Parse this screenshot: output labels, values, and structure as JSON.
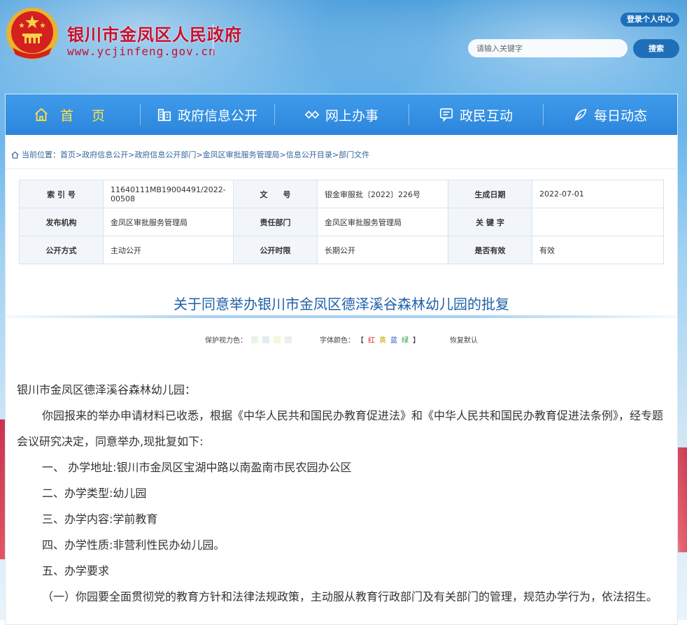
{
  "header": {
    "site_title": "银川市金凤区人民政府",
    "site_url": "www.ycjinfeng.gov.cn",
    "login_label": "登录个人中心",
    "search_placeholder": "请输入关键字",
    "search_button": "搜索"
  },
  "nav": {
    "items": [
      {
        "label": "首 页",
        "icon": "home-icon"
      },
      {
        "label": "政府信息公开",
        "icon": "building-icon"
      },
      {
        "label": "网上办事",
        "icon": "handshake-icon"
      },
      {
        "label": "政民互动",
        "icon": "chat-icon"
      },
      {
        "label": "每日动态",
        "icon": "leaf-icon"
      }
    ]
  },
  "breadcrumb": {
    "prefix": "当前位置：",
    "items": [
      "首页",
      "政府信息公开",
      "政府信息公开部门",
      "金凤区审批服务管理局",
      "信息公开目录",
      "部门文件"
    ],
    "separator": ">"
  },
  "meta": {
    "rows": [
      [
        {
          "k": "索 引 号",
          "v": "11640111MB19004491/2022-00508"
        },
        {
          "k": "文　　号",
          "v": "银金审服批〔2022〕226号"
        },
        {
          "k": "生成日期",
          "v": "2022-07-01"
        }
      ],
      [
        {
          "k": "发布机构",
          "v": "金凤区审批服务管理局"
        },
        {
          "k": "责任部门",
          "v": "金凤区审批服务管理局"
        },
        {
          "k": "关 键 字",
          "v": ""
        }
      ],
      [
        {
          "k": "公开方式",
          "v": "主动公开"
        },
        {
          "k": "公开时限",
          "v": "长期公开"
        },
        {
          "k": "是否有效",
          "v": "有效"
        }
      ]
    ]
  },
  "article": {
    "title": "关于同意举办银川市金凤区德泽溪谷森林幼儿园的批复",
    "tools": {
      "eye_label": "保护视力色：",
      "font_label": "字体颜色：",
      "bracket_open": "【",
      "red": "红",
      "yellow": "黄",
      "blue": "蓝",
      "green": "绿",
      "bracket_close": "】",
      "reset": "恢复默认"
    },
    "paragraphs": [
      "银川市金凤区德泽溪谷森林幼儿园：",
      "你园报来的举办申请材料已收悉，根据《中华人民共和国民办教育促进法》和《中华人民共和国民办教育促进法条例》，经专题会议研究决定，同意举办,现批复如下:",
      "一、 办学地址:银川市金凤区宝湖中路以南盈南市民农园办公区",
      "二、办学类型:幼儿园",
      "三、办学内容:学前教育",
      "四、办学性质:非营利性民办幼儿园。",
      "五、办学要求",
      "（一）你园要全面贯彻党的教育方针和法律法规政策，主动服从教育行政部门及有关部门的管理，规范办学行为，依法招生。"
    ]
  },
  "colors": {
    "nav_blue": "#2c86dc",
    "title_red": "#c8102e",
    "swatches": [
      "#e8f5e6",
      "#e2ecf2",
      "#f8f6dc",
      "#eeeeee"
    ]
  }
}
